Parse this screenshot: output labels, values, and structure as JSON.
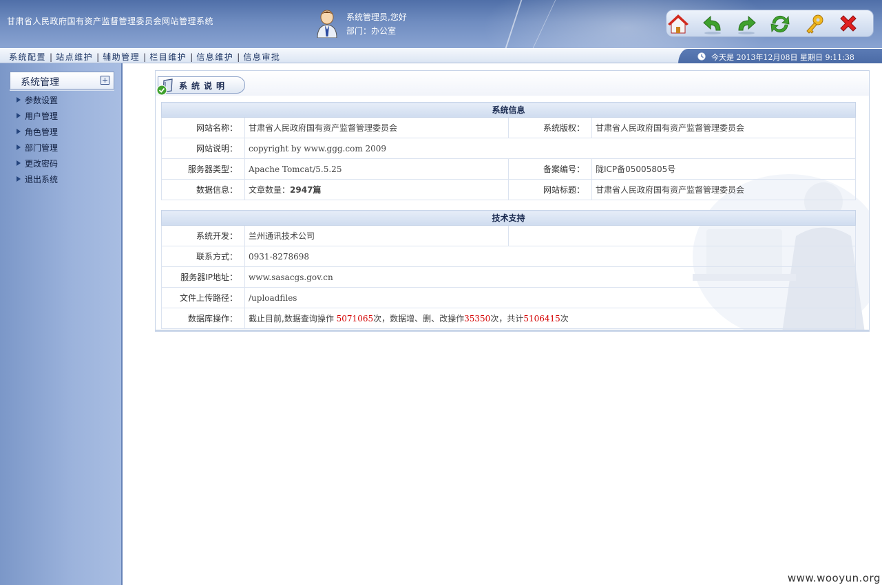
{
  "header": {
    "site_title": "甘肃省人民政府国有资产监督管理委员会网站管理系统",
    "greeting": "系统管理员,您好",
    "dept_label": "部门：",
    "dept_value": "办公室",
    "toolbar_icons": [
      "home-icon",
      "back-icon",
      "forward-icon",
      "refresh-icon",
      "key-icon",
      "close-icon"
    ]
  },
  "nav": {
    "items": [
      "系统配置",
      "站点维护",
      "辅助管理",
      "栏目维护",
      "信息维护",
      "信息审批"
    ],
    "date_text": "今天是 2013年12月08日 星期日 9:11:38"
  },
  "sidebar": {
    "title": "系统管理",
    "items": [
      "参数设置",
      "用户管理",
      "角色管理",
      "部门管理",
      "更改密码",
      "退出系统"
    ]
  },
  "panel": {
    "title": "系统说明",
    "system_info": {
      "heading": "系统信息",
      "site_name_label": "网站名称：",
      "site_name": "甘肃省人民政府国有资产监督管理委员会",
      "copyright_label": "系统版权：",
      "copyright": "甘肃省人民政府国有资产监督管理委员会",
      "site_desc_label": "网站说明：",
      "site_desc": "copyright by www.ggg.com 2009",
      "server_type_label": "服务器类型：",
      "server_type": "Apache Tomcat/5.5.25",
      "icp_label": "备案编号：",
      "icp": "陇ICP备05005805号",
      "data_info_label": "数据信息：",
      "article_count_prefix": "文章数量：",
      "article_count": "2947篇",
      "site_title_label": "网站标题：",
      "site_title": "甘肃省人民政府国有资产监督管理委员会"
    },
    "tech_support": {
      "heading": "技术支持",
      "developer_label": "系统开发：",
      "developer": "兰州通讯技术公司",
      "contact_label": "联系方式：",
      "contact": "0931-8278698",
      "server_ip_label": "服务器IP地址：",
      "server_ip": "www.sasacgs.gov.cn",
      "upload_path_label": "文件上传路径：",
      "upload_path": "/uploadfiles",
      "db_ops_label": "数据库操作：",
      "db_ops_prefix": "截止目前,数据查询操作",
      "db_query_count": "5071065",
      "db_ops_mid": "次，数据增、删、改操作",
      "db_modify_count": "35350",
      "db_ops_total_prefix": "次，共计",
      "db_total_count": "5106415",
      "db_ops_suffix": "次"
    }
  },
  "watermark": "www.wooyun.org"
}
